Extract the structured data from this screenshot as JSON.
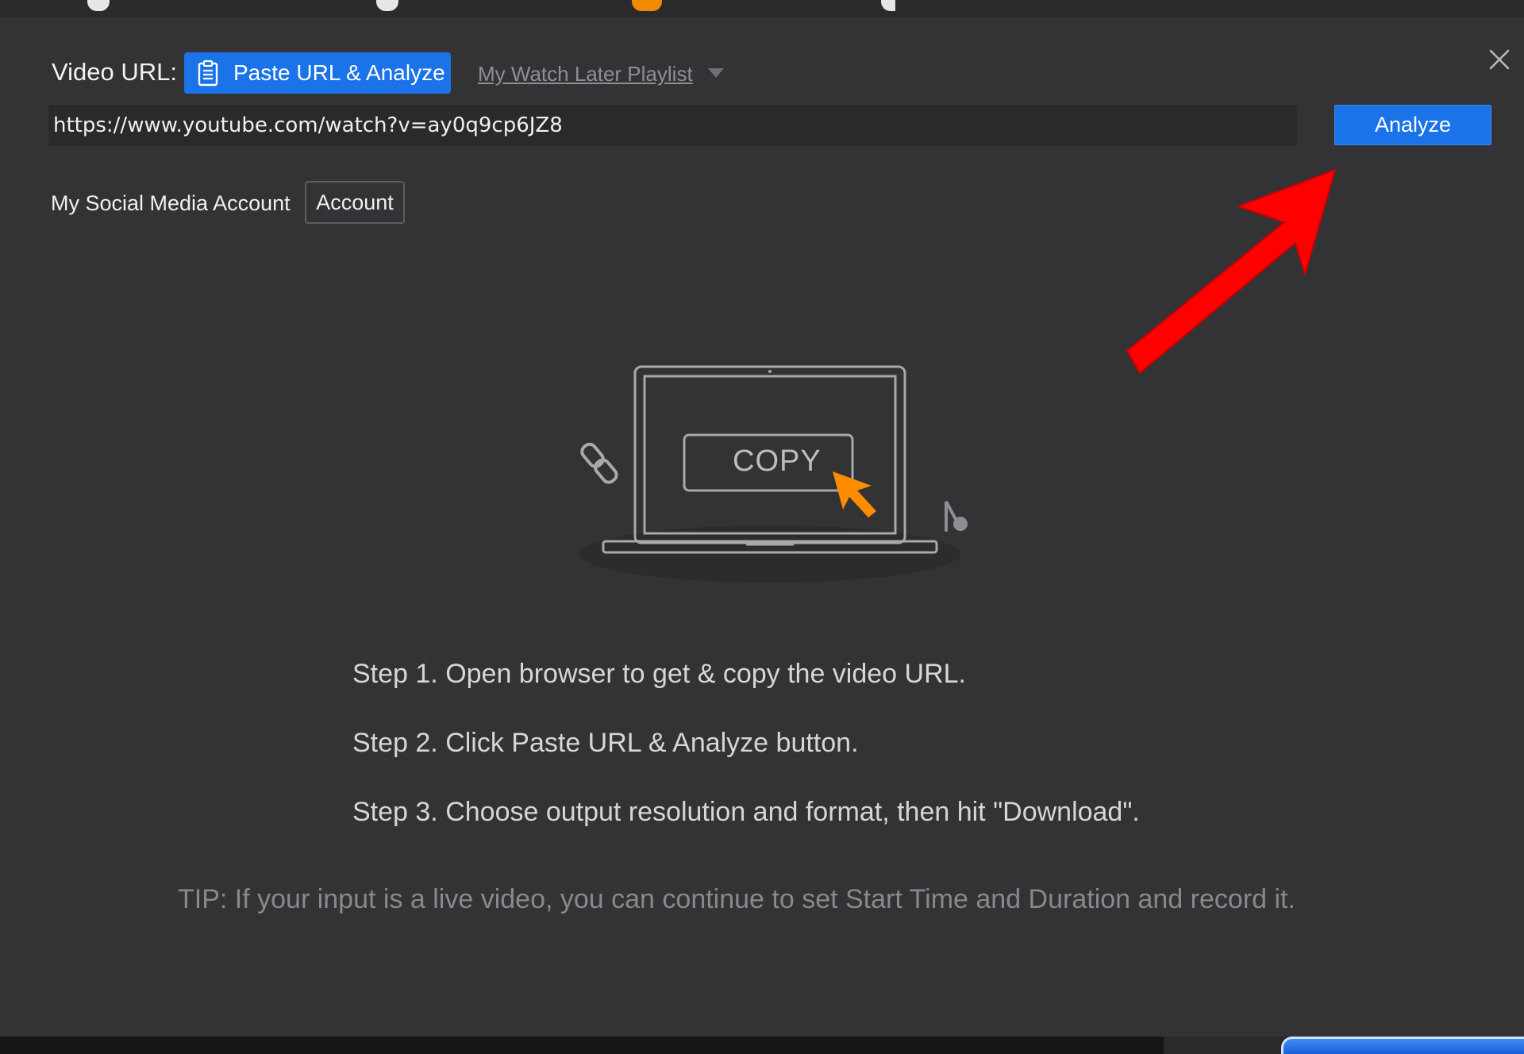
{
  "colors": {
    "dialog_bg": "#333336",
    "accent_blue": "#1a73e8",
    "cursor_orange": "#ff8c00",
    "annotation_red": "#ff0000"
  },
  "header": {
    "video_url_label": "Video URL:",
    "paste_button_label": "Paste URL & Analyze",
    "paste_button_icon": "clipboard-icon",
    "watch_later_label": "My Watch Later Playlist"
  },
  "url_bar": {
    "value": "https://www.youtube.com/watch?v=ay0q9cp6JZ8",
    "analyze_label": "Analyze"
  },
  "social": {
    "label": "My Social Media Account",
    "account_button": "Account"
  },
  "illustration": {
    "copy_text": "COPY"
  },
  "steps": [
    "Step 1. Open browser to get & copy the video URL.",
    "Step 2. Click Paste URL & Analyze button.",
    "Step 3. Choose output resolution and format, then hit \"Download\"."
  ],
  "tip": "TIP: If your input is a live video, you can continue to set Start Time and Duration and record it."
}
